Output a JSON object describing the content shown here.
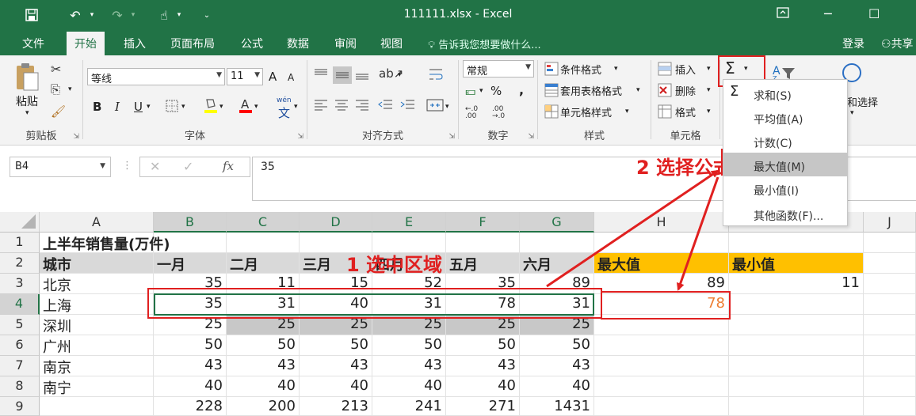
{
  "titlebar": {
    "title": "111111.xlsx - Excel",
    "save_icon": "save-icon",
    "undo_icon": "undo-icon",
    "redo_icon": "redo-icon",
    "touch_icon": "touch-mode-icon"
  },
  "tabs": {
    "items": [
      "文件",
      "开始",
      "插入",
      "页面布局",
      "公式",
      "数据",
      "审阅",
      "视图"
    ],
    "active": "开始",
    "tell_me": "告诉我您想要做什么...",
    "login": "登录",
    "share": "共享"
  },
  "ribbon": {
    "clipboard": {
      "paste": "粘贴",
      "label": "剪贴板"
    },
    "font": {
      "name": "等线",
      "size": "11",
      "bold": "B",
      "italic": "I",
      "underline": "U",
      "grow": "A",
      "shrink": "A",
      "label": "字体",
      "wen": "wén",
      "wen_char": "文"
    },
    "alignment": {
      "label": "对齐方式"
    },
    "number": {
      "format": "常规",
      "percent": "%",
      "comma": ",",
      "label": "数字"
    },
    "styles": {
      "conditional": "条件格式",
      "table": "套用表格格式",
      "cell": "单元格样式",
      "label": "样式"
    },
    "cells": {
      "insert": "插入",
      "delete": "删除",
      "format": "格式",
      "label": "单元格"
    },
    "editing": {
      "sigma": "Σ",
      "find_select": "和选择"
    }
  },
  "formula_bar": {
    "name_box": "B4",
    "fx": "fx",
    "value": "35"
  },
  "grid": {
    "columns": [
      "A",
      "B",
      "C",
      "D",
      "E",
      "F",
      "G",
      "H",
      "",
      "J"
    ],
    "rows": [
      "1",
      "2",
      "3",
      "4",
      "5",
      "6",
      "7",
      "8",
      "9"
    ],
    "title": "上半年销售量(万件)",
    "header": [
      "城市",
      "一月",
      "二月",
      "三月",
      "四月",
      "五月",
      "六月",
      "最大值",
      "最小值"
    ],
    "data": [
      [
        "北京",
        "35",
        "11",
        "15",
        "52",
        "35",
        "89",
        "89",
        "11"
      ],
      [
        "上海",
        "35",
        "31",
        "40",
        "31",
        "78",
        "31",
        "78",
        ""
      ],
      [
        "深圳",
        "25",
        "25",
        "25",
        "25",
        "25",
        "25",
        "",
        ""
      ],
      [
        "广州",
        "50",
        "50",
        "50",
        "50",
        "50",
        "50",
        "",
        ""
      ],
      [
        "南京",
        "43",
        "43",
        "43",
        "43",
        "43",
        "43",
        "",
        ""
      ],
      [
        "南宁",
        "40",
        "40",
        "40",
        "40",
        "40",
        "40",
        "",
        ""
      ],
      [
        "",
        "228",
        "200",
        "213",
        "241",
        "271",
        "1431",
        "",
        ""
      ]
    ]
  },
  "menu": {
    "items": [
      {
        "label": "求和(S)",
        "icon": "Σ"
      },
      {
        "label": "平均值(A)"
      },
      {
        "label": "计数(C)"
      },
      {
        "label": "最大值(M)"
      },
      {
        "label": "最小值(I)"
      },
      {
        "label": "其他函数(F)..."
      }
    ],
    "highlighted": "最大值(M)"
  },
  "annotations": {
    "step1": "1 选中区域",
    "step2": "2 选择公式"
  },
  "colors": {
    "excel_green": "#217346",
    "annotation_red": "#e02020",
    "header_orange": "#ffc000",
    "value_orange": "#ed7d31"
  }
}
